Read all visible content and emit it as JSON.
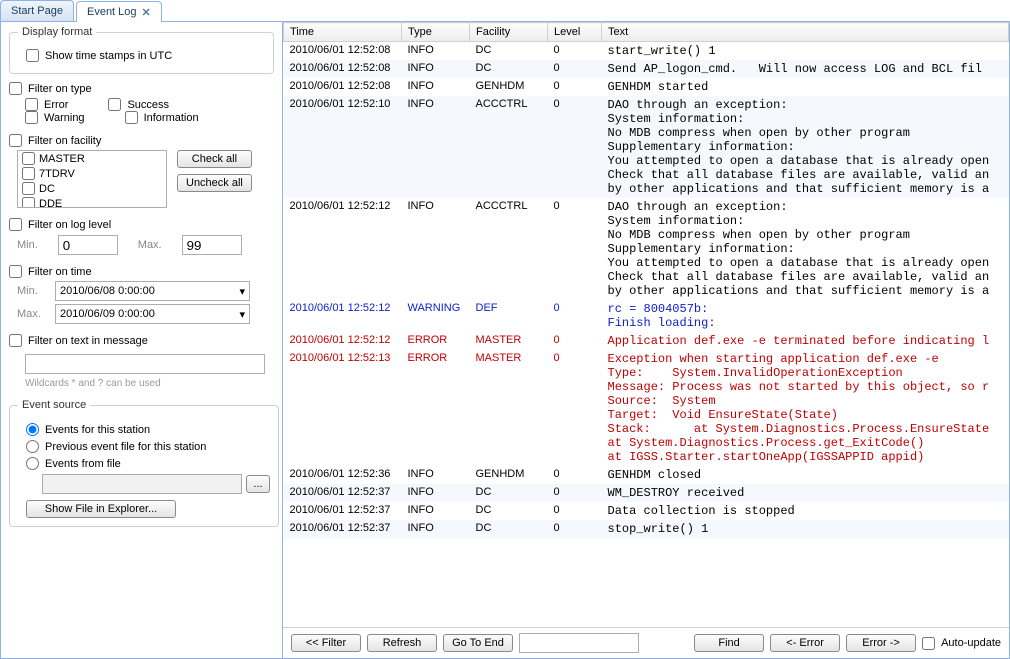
{
  "tabs": {
    "start": "Start Page",
    "eventlog": "Event Log"
  },
  "sidebar": {
    "display_format": {
      "title": "Display format",
      "utc": "Show time stamps in UTC"
    },
    "filter_type": {
      "title": "Filter on type",
      "error": "Error",
      "success": "Success",
      "warning": "Warning",
      "information": "Information"
    },
    "filter_facility": {
      "title": "Filter on facility",
      "items": [
        "MASTER",
        "7TDRV",
        "DC",
        "DDE"
      ],
      "check_all": "Check all",
      "uncheck_all": "Uncheck all"
    },
    "filter_level": {
      "title": "Filter on log level",
      "min": "Min.",
      "max": "Max.",
      "min_val": "0",
      "max_val": "99"
    },
    "filter_time": {
      "title": "Filter on time",
      "min": "Min.",
      "max": "Max.",
      "min_val": "2010/06/08 0:00:00",
      "max_val": "2010/06/09 0:00:00"
    },
    "filter_text": {
      "title": "Filter on text in message",
      "hint": "Wildcards * and ? can be used"
    },
    "source": {
      "title": "Event source",
      "station": "Events for this station",
      "previous": "Previous event file for this station",
      "file": "Events from file",
      "browse": "...",
      "show": "Show File in Explorer..."
    }
  },
  "columns": {
    "time": "Time",
    "type": "Type",
    "facility": "Facility",
    "level": "Level",
    "text": "Text"
  },
  "rows": [
    {
      "time": "2010/06/01 12:52:08",
      "type": "INFO",
      "fac": "DC",
      "lvl": "0",
      "cls": "",
      "text": "start_write() 1"
    },
    {
      "time": "2010/06/01 12:52:08",
      "type": "INFO",
      "fac": "DC",
      "lvl": "0",
      "cls": "alt",
      "text": "Send AP_logon_cmd.   Will now access LOG and BCL fil"
    },
    {
      "time": "2010/06/01 12:52:08",
      "type": "INFO",
      "fac": "GENHDM",
      "lvl": "0",
      "cls": "",
      "text": "GENHDM started"
    },
    {
      "time": "2010/06/01 12:52:10",
      "type": "INFO",
      "fac": "ACCCTRL",
      "lvl": "0",
      "cls": "alt",
      "text": "DAO through an exception:\nSystem information:\nNo MDB compress when open by other program\nSupplementary information:\nYou attempted to open a database that is already open\nCheck that all database files are available, valid an\nby other applications and that sufficient memory is a"
    },
    {
      "time": "2010/06/01 12:52:12",
      "type": "INFO",
      "fac": "ACCCTRL",
      "lvl": "0",
      "cls": "",
      "text": "DAO through an exception:\nSystem information:\nNo MDB compress when open by other program\nSupplementary information:\nYou attempted to open a database that is already open\nCheck that all database files are available, valid an\nby other applications and that sufficient memory is a"
    },
    {
      "time": "2010/06/01 12:52:12",
      "type": "WARNING",
      "fac": "DEF",
      "lvl": "0",
      "cls": "warn",
      "text": "rc = 8004057b:\nFinish loading:"
    },
    {
      "time": "2010/06/01 12:52:12",
      "type": "ERROR",
      "fac": "MASTER",
      "lvl": "0",
      "cls": "err",
      "text": "Application def.exe -e terminated before indicating l"
    },
    {
      "time": "2010/06/01 12:52:13",
      "type": "ERROR",
      "fac": "MASTER",
      "lvl": "0",
      "cls": "err",
      "text": "Exception when starting application def.exe -e\nType:    System.InvalidOperationException\nMessage: Process was not started by this object, so r\nSource:  System\nTarget:  Void EnsureState(State)\nStack:      at System.Diagnostics.Process.EnsureState\nat System.Diagnostics.Process.get_ExitCode()\nat IGSS.Starter.startOneApp(IGSSAPPID appid)"
    },
    {
      "time": "2010/06/01 12:52:36",
      "type": "INFO",
      "fac": "GENHDM",
      "lvl": "0",
      "cls": "",
      "text": "GENHDM closed"
    },
    {
      "time": "2010/06/01 12:52:37",
      "type": "INFO",
      "fac": "DC",
      "lvl": "0",
      "cls": "alt",
      "text": "WM_DESTROY received"
    },
    {
      "time": "2010/06/01 12:52:37",
      "type": "INFO",
      "fac": "DC",
      "lvl": "0",
      "cls": "",
      "text": "Data collection is stopped"
    },
    {
      "time": "2010/06/01 12:52:37",
      "type": "INFO",
      "fac": "DC",
      "lvl": "0",
      "cls": "alt",
      "text": "stop_write() 1"
    }
  ],
  "toolbar": {
    "filter": "<< Filter",
    "refresh": "Refresh",
    "gotoend": "Go To End",
    "find": "Find",
    "prev_err": "<- Error",
    "next_err": "Error ->",
    "auto": "Auto-update"
  }
}
